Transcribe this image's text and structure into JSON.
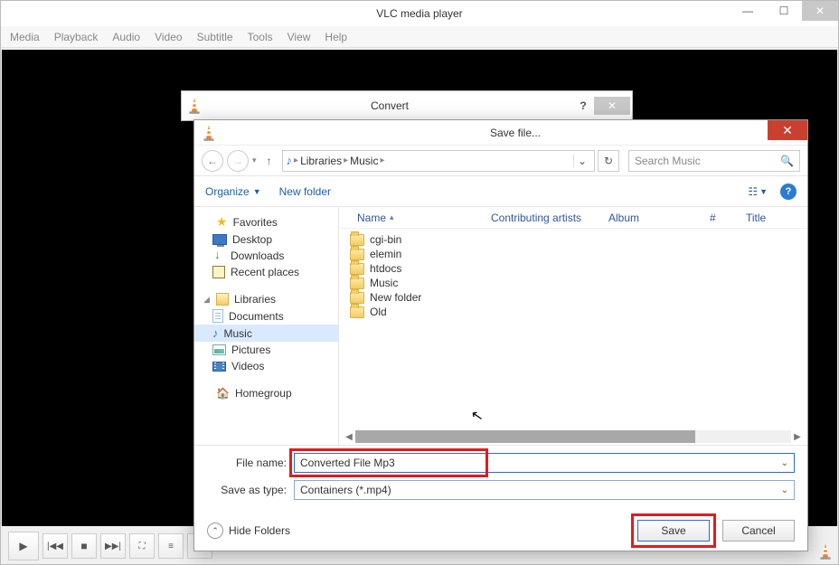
{
  "vlc": {
    "title": "VLC media player",
    "menu": [
      "Media",
      "Playback",
      "Audio",
      "Video",
      "Subtitle",
      "Tools",
      "View",
      "Help"
    ]
  },
  "convert": {
    "title": "Convert",
    "help": "?"
  },
  "save": {
    "title": "Save file...",
    "breadcrumb": {
      "root": "Libraries",
      "folder": "Music"
    },
    "search_placeholder": "Search Music",
    "toolbar": {
      "organize": "Organize",
      "newfolder": "New folder"
    },
    "tree": {
      "favorites": {
        "label": "Favorites",
        "items": [
          "Desktop",
          "Downloads",
          "Recent places"
        ]
      },
      "libraries": {
        "label": "Libraries",
        "items": [
          "Documents",
          "Music",
          "Pictures",
          "Videos"
        ],
        "selected": "Music"
      },
      "homegroup": {
        "label": "Homegroup"
      }
    },
    "columns": {
      "name": "Name",
      "contrib": "Contributing artists",
      "album": "Album",
      "num": "#",
      "title": "Title"
    },
    "files": [
      "cgi-bin",
      "elemin",
      "htdocs",
      "Music",
      "New folder",
      "Old"
    ],
    "fields": {
      "filename_label": "File name:",
      "filename_value": "Converted File Mp3",
      "saveas_label": "Save as type:",
      "saveas_value": "Containers (*.mp4)"
    },
    "footer": {
      "hide": "Hide Folders",
      "save": "Save",
      "cancel": "Cancel"
    }
  }
}
